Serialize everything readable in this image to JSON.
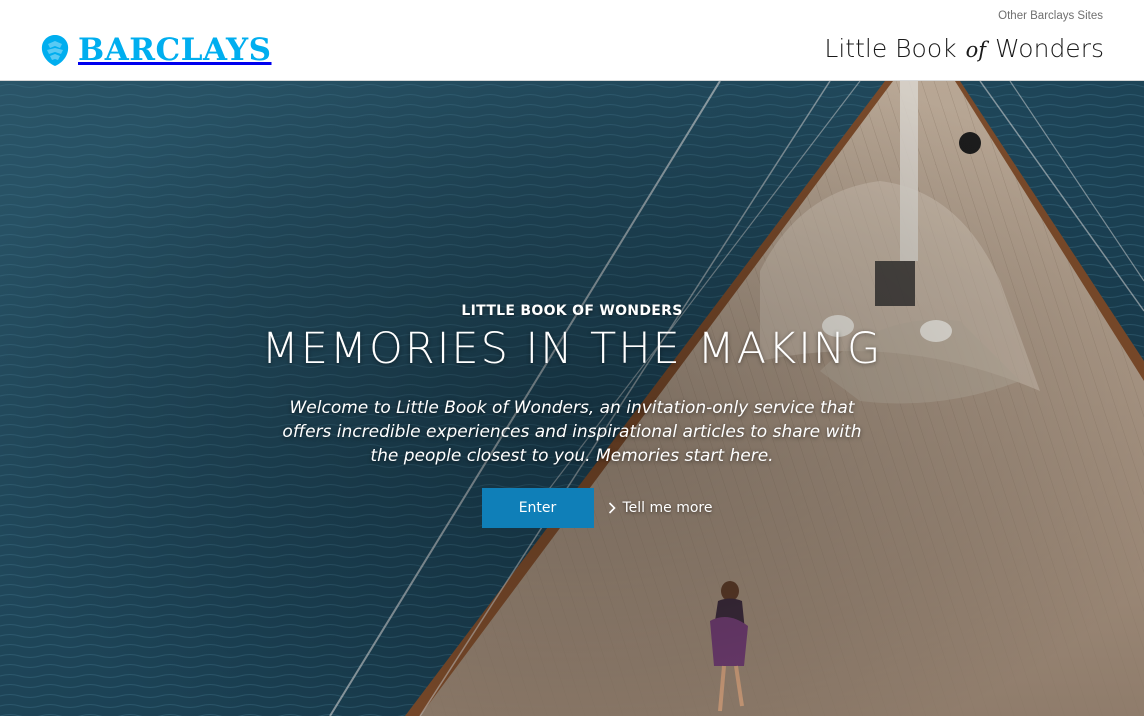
{
  "header": {
    "other_sites_label": "Other Barclays Sites",
    "logo_text": "BARCLAYS",
    "product_title": {
      "part1": "Little Book",
      "part2": "of",
      "part3": "Wonders"
    }
  },
  "hero": {
    "eyebrow": "LITTLE BOOK OF WONDERS",
    "headline": "MEMORIES IN THE MAKING",
    "intro": "Welcome to Little Book of Wonders, an invitation-only service that offers incredible experiences and inspirational articles to share with the people closest to you. Memories start here.",
    "enter_label": "Enter",
    "more_label": "Tell me more",
    "background_image": "aerial view of a sailing yacht deck on dark blue sea with a woman walking"
  },
  "icons": {
    "logo": "eagle-icon",
    "more": "chevron-right-icon"
  },
  "colors": {
    "brand": "#00aeef",
    "button": "#0f7fb8",
    "sea": "#1e4557"
  }
}
